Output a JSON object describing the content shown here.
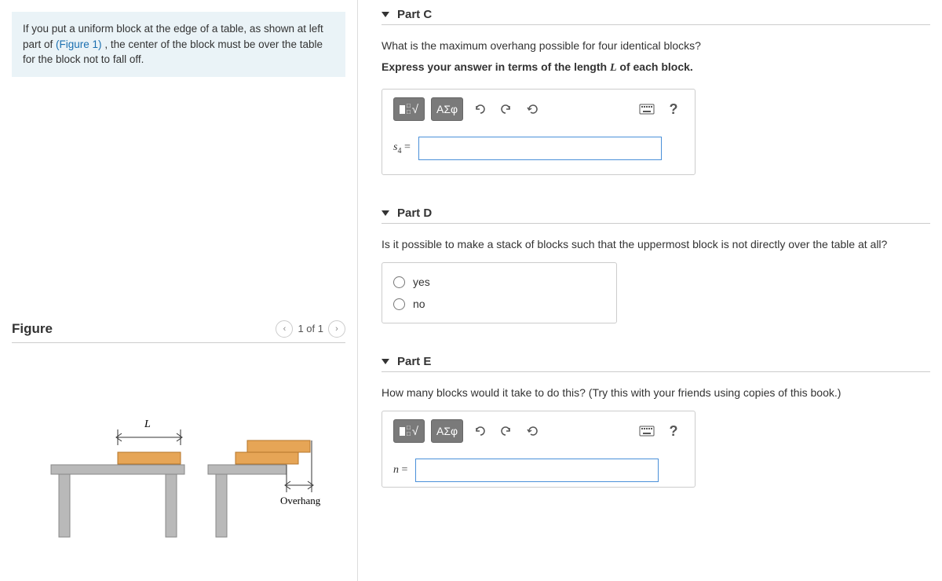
{
  "intro": {
    "prefix": "If you put a uniform block at the edge of a table, as shown at left part of ",
    "link": "(Figure 1)",
    "suffix": ", the center of the block must be over the table for the block not to fall off."
  },
  "figure": {
    "title": "Figure",
    "pager": "1 of 1",
    "label_L": "L",
    "label_overhang": "Overhang"
  },
  "partC": {
    "title": "Part C",
    "question": "What is the maximum overhang possible for four identical blocks?",
    "instruction_pre": "Express your answer in terms of the length ",
    "instruction_var": "L",
    "instruction_post": " of each block.",
    "label_var": "s",
    "label_sub": "4",
    "label_eq": " =",
    "toolbar": {
      "greek": "ΑΣφ",
      "help": "?"
    }
  },
  "partD": {
    "title": "Part D",
    "question": "Is it possible to make a stack of blocks such that the uppermost block is not directly over the table at all?",
    "opt1": "yes",
    "opt2": "no"
  },
  "partE": {
    "title": "Part E",
    "question": "How many blocks would it take to do this? (Try this with your friends using copies of this book.)",
    "label_var": "n",
    "label_eq": " =",
    "toolbar": {
      "greek": "ΑΣφ",
      "help": "?"
    }
  }
}
